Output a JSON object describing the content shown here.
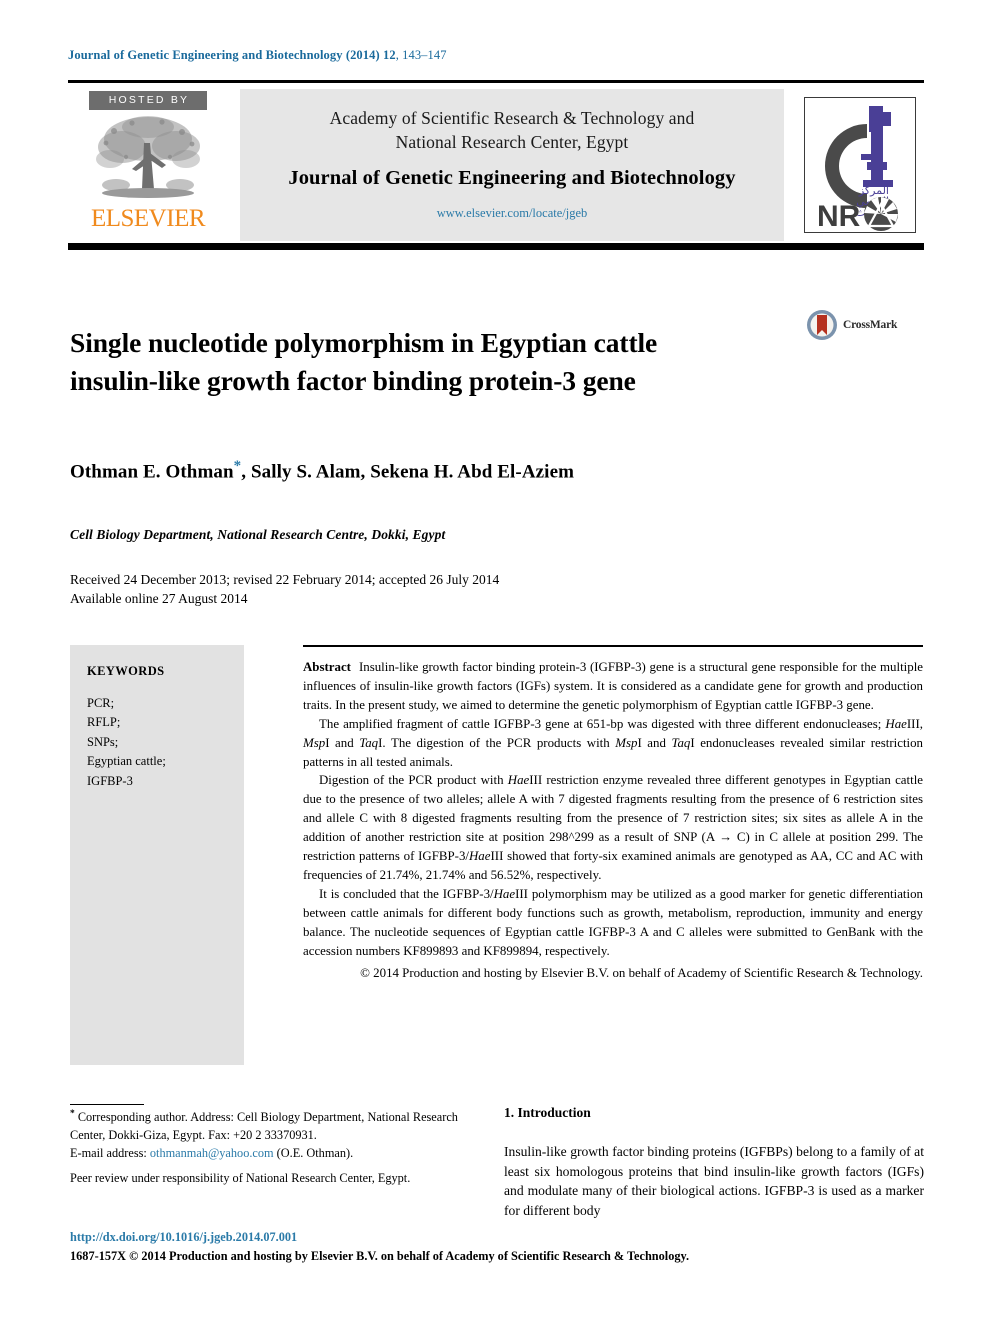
{
  "running_head": {
    "journal": "Journal of Genetic Engineering and Biotechnology (2014)",
    "volume": "12",
    "pages": ", 143–147"
  },
  "masthead": {
    "hosted_by": "HOSTED BY",
    "publisher_name": "ELSEVIER",
    "society_line_1": "Academy of Scientific Research & Technology and",
    "society_line_2": "National Research Center, Egypt",
    "journal_title": "Journal of Genetic Engineering and Biotechnology",
    "journal_url": "www.elsevier.com/locate/jgeb",
    "nrc_acronym": "NRC",
    "nrc_arabic_1": "المركز",
    "nrc_arabic_2": "القومي",
    "nrc_arabic_3": "للبحوث"
  },
  "article": {
    "title": "Single nucleotide polymorphism in Egyptian cattle insulin-like growth factor binding protein-3 gene",
    "crossmark_label": "CrossMark",
    "authors": "Othman E. Othman",
    "corresponding_marker": "*",
    "authors_rest": ", Sally S. Alam, Sekena H. Abd El-Aziem",
    "affiliation": "Cell Biology Department, National Research Centre, Dokki, Egypt",
    "history_line_1": "Received 24 December 2013; revised 22 February 2014; accepted 26 July 2014",
    "history_line_2": "Available online 27 August 2014"
  },
  "keywords": {
    "heading": "KEYWORDS",
    "items": [
      "PCR;",
      "RFLP;",
      "SNPs;",
      "Egyptian cattle;",
      "IGFBP-3"
    ]
  },
  "abstract": {
    "label": "Abstract",
    "p1": "Insulin-like growth factor binding protein-3 (IGFBP-3) gene is a structural gene responsible for the multiple influences of insulin-like growth factors (IGFs) system. It is considered as a candidate gene for growth and production traits. In the present study, we aimed to determine the genetic polymorphism of Egyptian cattle IGFBP-3 gene.",
    "p2_a": "The amplified fragment of cattle IGFBP-3 gene at 651-bp was digested with three different endonucleases; ",
    "p2_hae": "Hae",
    "p2_b": "III, ",
    "p2_msp": "Msp",
    "p2_c": "I and ",
    "p2_taq": "Taq",
    "p2_d": "I. The digestion of the PCR products with ",
    "p2_msp2": "Msp",
    "p2_e": "I and ",
    "p2_taq2": "Taq",
    "p2_f": "I endonucleases revealed similar restriction patterns in all tested animals.",
    "p3_a": "Digestion of the PCR product with ",
    "p3_hae": "Hae",
    "p3_b": "III restriction enzyme revealed three different genotypes in Egyptian cattle due to the presence of two alleles; allele A with 7 digested fragments resulting from the presence of 6 restriction sites and allele C with 8 digested fragments resulting from the presence of 7 restriction sites; six sites as allele A in the addition of another restriction site at position 298^299 as a result of SNP (A → C) in C allele at position 299. The restriction patterns of IGFBP-3/",
    "p3_hae2": "Hae",
    "p3_c": "III showed that forty-six examined animals are genotyped as AA, CC and AC with frequencies of 21.74%, 21.74% and 56.52%, respectively.",
    "p4_a": "It is concluded that the IGFBP-3/",
    "p4_hae": "Hae",
    "p4_b": "III polymorphism may be utilized as a good marker for genetic differentiation between cattle animals for different body functions such as growth, metabolism, reproduction, immunity and energy balance. The nucleotide sequences of Egyptian cattle IGFBP-3 A and C alleles were submitted to GenBank with the accession numbers KF899893 and KF899894, respectively.",
    "copyright": "© 2014 Production and hosting by Elsevier B.V. on behalf of Academy of Scientific Research & Technology."
  },
  "footnotes": {
    "corresponding_marker": "*",
    "corresponding_text": " Corresponding author. Address: Cell Biology Department, National Research Center, Dokki-Giza, Egypt. Fax: +20 2 33370931.",
    "email_label": "E-mail address: ",
    "email": "othmanmah@yahoo.com",
    "email_suffix": " (O.E. Othman).",
    "peer_review": "Peer review under responsibility of National Research Center, Egypt."
  },
  "footer": {
    "doi": "http://dx.doi.org/10.1016/j.jgeb.2014.07.001",
    "issn_line": "1687-157X © 2014 Production and hosting by Elsevier B.V. on behalf of Academy of Scientific Research & Technology."
  },
  "introduction": {
    "heading": "1. Introduction",
    "paragraph": "Insulin-like growth factor binding proteins (IGFBPs) belong to a family of at least six homologous proteins that bind insulin-like growth factors (IGFs) and modulate many of their biological actions. IGFBP-3 is used as a marker for different body"
  },
  "colors": {
    "link_blue": "#2a7aa8",
    "elsevier_orange": "#f08a1d",
    "hosted_by_grey": "#6d6d6d",
    "panel_grey": "#e6e6e6",
    "keyword_grey": "#e2e2e2",
    "nrc_purple": "#4a3f96",
    "nrc_darkgrey": "#4a4a4a",
    "crossmark_red": "#b5311f",
    "crossmark_blue": "#7b93ad"
  }
}
